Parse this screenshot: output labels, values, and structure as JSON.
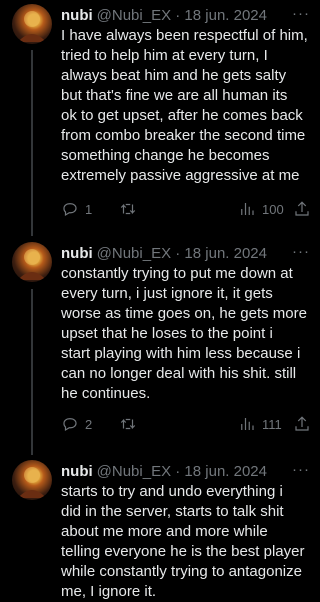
{
  "tweets": [
    {
      "name": "nubi",
      "handle_date": "@Nubi_EX · 18 jun. 2024",
      "text": "I have always been respectful of him,\ntried to help him at every turn, I\nalways beat him and he gets salty\nbut that's fine we are all human its\nok to get upset, after he comes back\nfrom combo breaker the second time\nsomething change he becomes\nextremely passive aggressive at me",
      "replies": "1",
      "retweets": "",
      "views": "100"
    },
    {
      "name": "nubi",
      "handle_date": "@Nubi_EX · 18 jun. 2024",
      "text": "constantly trying to put me down at\nevery turn, i just ignore it, it gets\nworse as time goes on, he gets more\nupset that he loses to the point i\nstart playing with him less because i\ncan no longer deal with his shit. still\nhe continues.",
      "replies": "2",
      "retweets": "",
      "views": "111"
    },
    {
      "name": "nubi",
      "handle_date": "@Nubi_EX · 18 jun. 2024",
      "text": "starts to try and undo everything i\ndid in the server, starts to talk shit\nabout me more and more while\ntelling everyone he is the best player\nwhile constantly trying to antagonize\nme, I ignore it.",
      "replies": "",
      "retweets": "",
      "views": ""
    }
  ],
  "icons": {
    "reply": "reply-icon",
    "retweet": "retweet-icon",
    "like": "like-icon",
    "views": "views-icon",
    "share": "share-icon",
    "more": "more-icon"
  },
  "colors": {
    "background": "#000000",
    "text": "#e7e9ea",
    "secondary": "#71767b",
    "thread_line": "#333639"
  }
}
